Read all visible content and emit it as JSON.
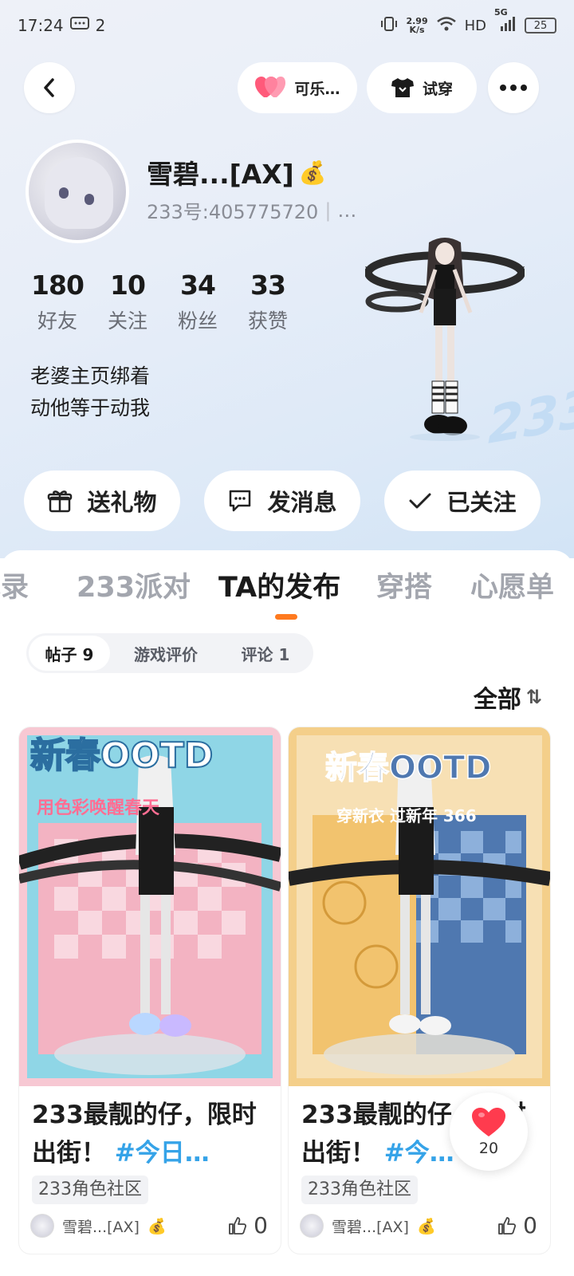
{
  "status_bar": {
    "time": "17:24",
    "notif_count": "2",
    "net_speed_value": "2.99",
    "net_speed_unit": "K/s",
    "network": "HD",
    "signal_label": "5G",
    "battery": "25"
  },
  "topbar": {
    "pet_label": "可乐…",
    "try_on_label": "试穿"
  },
  "profile": {
    "name": "雪碧...[AX]",
    "uid": "233号:405775720",
    "uid_more": "…",
    "stats": [
      {
        "value": "180",
        "label": "好友"
      },
      {
        "value": "10",
        "label": "关注"
      },
      {
        "value": "34",
        "label": "粉丝"
      },
      {
        "value": "33",
        "label": "获赞"
      }
    ],
    "bio_line1": "老婆主页绑着",
    "bio_line2": "动他等于动我"
  },
  "actions": {
    "gift": "送礼物",
    "message": "发消息",
    "followed": "已关注"
  },
  "tabs": [
    "记录",
    "233派对",
    "TA的发布",
    "穿搭",
    "心愿单"
  ],
  "active_tab": "TA的发布",
  "subtabs": [
    "帖子 9",
    "游戏评价",
    "评论 1"
  ],
  "sort_label": "全部",
  "cards": [
    {
      "poster_title": "新春OOTD",
      "poster_subtitle": "用色彩唤醒春天",
      "title_text": "233最靓的仔，限时出街！",
      "title_tag": "#今日…",
      "community": "233角色社区",
      "author": "雪碧...[AX]",
      "likes": "0"
    },
    {
      "poster_title": "新春OOTD",
      "poster_subtitle": "穿新衣 过新年 366",
      "title_text": "233最靓的仔，限时出街！",
      "title_tag": "#今…",
      "community": "233角色社区",
      "author": "雪碧...[AX]",
      "likes": "0"
    }
  ],
  "float_like_count": "20",
  "colors": {
    "accent_orange": "#ff7a1f",
    "tag_blue": "#35a3e8",
    "heart_red": "#ff3b4e"
  }
}
